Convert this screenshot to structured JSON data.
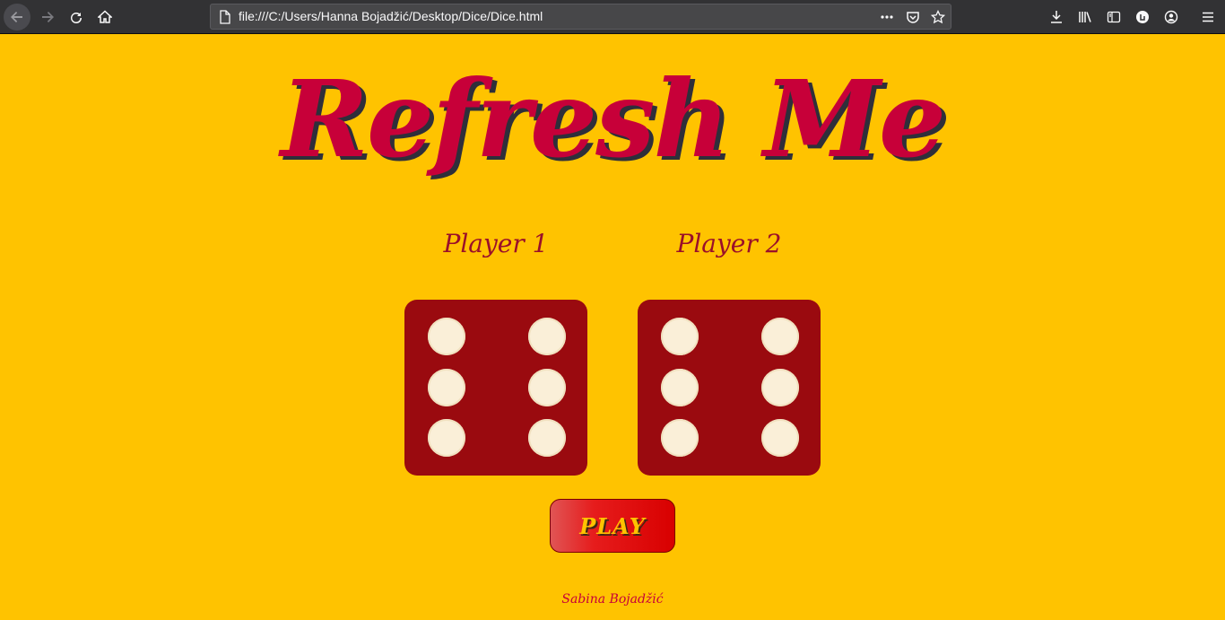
{
  "browser": {
    "url": "file:///C:/Users/Hanna Bojadžić/Desktop/Dice/Dice.html",
    "icons": [
      "back-icon",
      "forward-icon",
      "reload-icon",
      "home-icon",
      "page-icon",
      "more-icon",
      "pocket-icon",
      "bookmark-star-icon",
      "download-icon",
      "library-icon",
      "sidebar-icon",
      "extension-icon",
      "account-icon",
      "menu-icon"
    ]
  },
  "page": {
    "title": "Refresh Me",
    "player1": "Player 1",
    "player2": "Player 2",
    "play_button": "PLAY",
    "author": "Sabina Bojadžić"
  },
  "dice": {
    "player1_value": 6,
    "player2_value": 6
  },
  "colors": {
    "background": "#FFC300",
    "title": "#C70039",
    "die": "#9A0A0F",
    "pip": "#FAEFD8"
  }
}
